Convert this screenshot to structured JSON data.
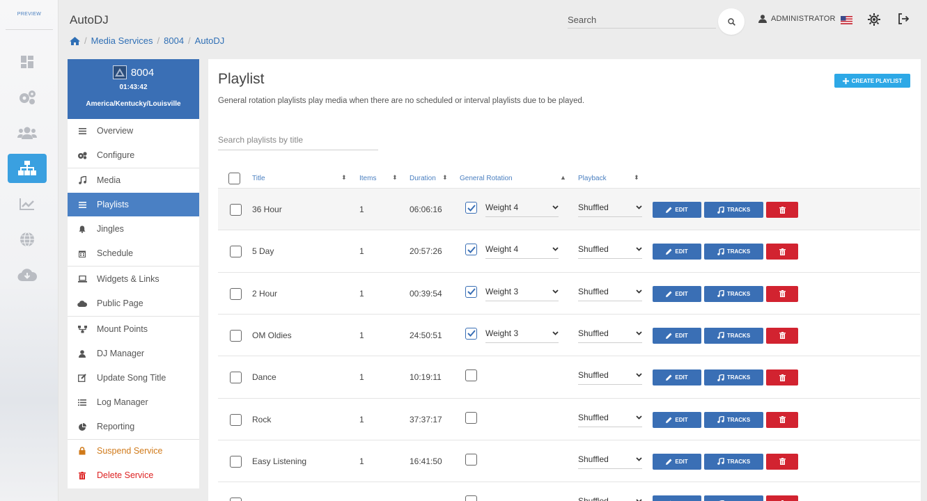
{
  "rail": {
    "preview_label": "PREVIEW",
    "items": [
      {
        "icon": "dashboard-icon"
      },
      {
        "icon": "cogs-icon"
      },
      {
        "icon": "users-icon"
      },
      {
        "icon": "sitemap-icon",
        "active": true
      },
      {
        "icon": "chart-icon"
      },
      {
        "icon": "globe-icon"
      },
      {
        "icon": "cloud-download-icon"
      }
    ]
  },
  "header": {
    "title": "AutoDJ",
    "breadcrumbs": [
      "Media Services",
      "8004",
      "AutoDJ"
    ],
    "search_placeholder": "Search",
    "user": "ADMINISTRATOR"
  },
  "service": {
    "name": "8004",
    "time": "01:43:42",
    "timezone": "America/Kentucky/Louisville"
  },
  "menu": {
    "items": [
      {
        "label": "Overview",
        "icon": "bars-icon"
      },
      {
        "label": "Configure",
        "icon": "cogs-icon"
      },
      {
        "label": "Media",
        "icon": "music-icon"
      },
      {
        "label": "Playlists",
        "icon": "list-icon",
        "active": true
      },
      {
        "label": "Jingles",
        "icon": "bell-icon"
      },
      {
        "label": "Schedule",
        "icon": "calendar-icon"
      },
      {
        "label": "Widgets & Links",
        "icon": "laptop-icon"
      },
      {
        "label": "Public Page",
        "icon": "cloud-icon"
      },
      {
        "label": "Mount Points",
        "icon": "sitemap-icon"
      },
      {
        "label": "DJ Manager",
        "icon": "user-icon"
      },
      {
        "label": "Update Song Title",
        "icon": "edit-icon"
      },
      {
        "label": "Log Manager",
        "icon": "list-ul-icon"
      },
      {
        "label": "Reporting",
        "icon": "pie-chart-icon"
      },
      {
        "label": "Suspend Service",
        "icon": "lock-icon"
      },
      {
        "label": "Delete Service",
        "icon": "trash-icon"
      }
    ]
  },
  "main": {
    "title": "Playlist",
    "description": "General rotation playlists play media when there are no scheduled or interval playlists due to be played.",
    "create_button": "CREATE PLAYLIST",
    "search_placeholder": "Search playlists by title",
    "columns": {
      "title": "Title",
      "items": "Items",
      "duration": "Duration",
      "general_rotation": "General Rotation",
      "playback": "Playback"
    },
    "buttons": {
      "edit": "EDIT",
      "tracks": "TRACKS"
    },
    "rows": [
      {
        "title": "36 Hour",
        "items": "1",
        "duration": "06:06:16",
        "rotation": true,
        "weight": "Weight 4",
        "playback": "Shuffled"
      },
      {
        "title": "5 Day",
        "items": "1",
        "duration": "20:57:26",
        "rotation": true,
        "weight": "Weight 4",
        "playback": "Shuffled"
      },
      {
        "title": "2 Hour",
        "items": "1",
        "duration": "00:39:54",
        "rotation": true,
        "weight": "Weight 3",
        "playback": "Shuffled"
      },
      {
        "title": "OM Oldies",
        "items": "1",
        "duration": "24:50:51",
        "rotation": true,
        "weight": "Weight 3",
        "playback": "Shuffled"
      },
      {
        "title": "Dance",
        "items": "1",
        "duration": "10:19:11",
        "rotation": false,
        "weight": "",
        "playback": "Shuffled"
      },
      {
        "title": "Rock",
        "items": "1",
        "duration": "37:37:17",
        "rotation": false,
        "weight": "",
        "playback": "Shuffled"
      },
      {
        "title": "Easy Listening",
        "items": "1",
        "duration": "16:41:50",
        "rotation": false,
        "weight": "",
        "playback": "Shuffled"
      },
      {
        "title": "",
        "items": "",
        "duration": "",
        "rotation": false,
        "weight": "",
        "playback": "Shuffled"
      }
    ]
  }
}
